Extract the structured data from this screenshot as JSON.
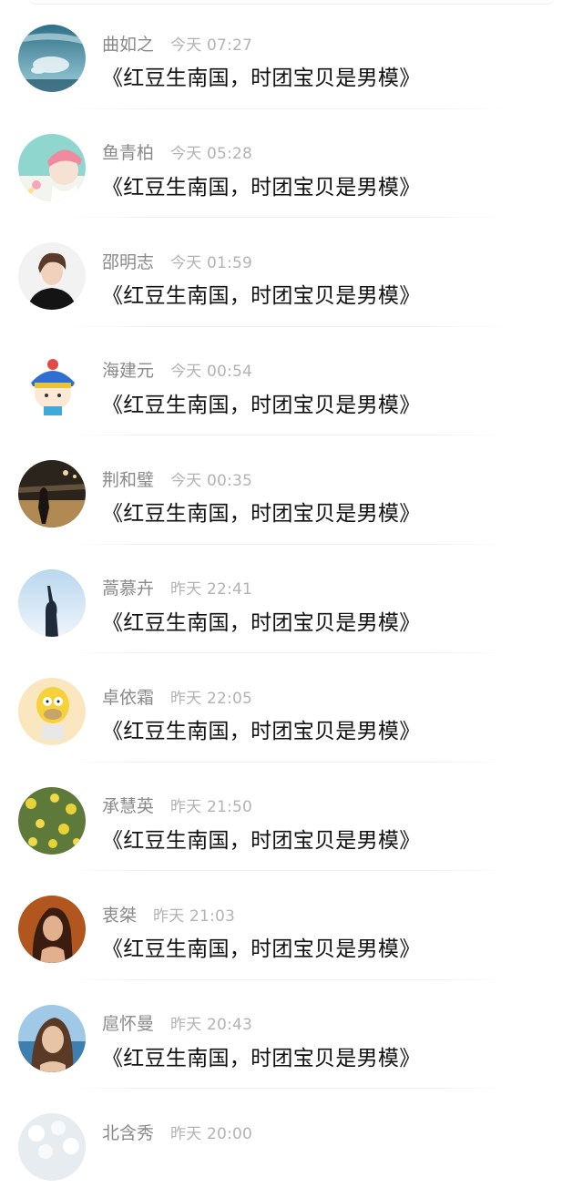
{
  "messages": [
    {
      "name": "曲如之",
      "time": "今天 07:27",
      "text": "《红豆生南国，时团宝贝是男模》",
      "avatar": "underwater-swimmer-avatar"
    },
    {
      "name": "鱼青柏",
      "time": "今天 05:28",
      "text": "《红豆生南国，时团宝贝是男模》",
      "avatar": "pink-hat-girl-avatar"
    },
    {
      "name": "邵明志",
      "time": "今天 01:59",
      "text": "《红豆生南国，时团宝贝是男模》",
      "avatar": "young-man-portrait-avatar"
    },
    {
      "name": "海建元",
      "time": "今天 00:54",
      "text": "《红豆生南国，时团宝贝是男模》",
      "avatar": "cartoon-qing-official-avatar"
    },
    {
      "name": "荆和璧",
      "time": "今天 00:35",
      "text": "《红豆生南国，时团宝贝是男模》",
      "avatar": "girl-at-night-avatar"
    },
    {
      "name": "蒿慕卉",
      "time": "昨天 22:41",
      "text": "《红豆生南国，时团宝贝是男模》",
      "avatar": "silhouette-sky-avatar"
    },
    {
      "name": "卓依霜",
      "time": "昨天 22:05",
      "text": "《红豆生南国，时团宝贝是男模》",
      "avatar": "cartoon-homer-avatar"
    },
    {
      "name": "承慧英",
      "time": "昨天 21:50",
      "text": "《红豆生南国，时团宝贝是男模》",
      "avatar": "yellow-flowers-avatar"
    },
    {
      "name": "衷桀",
      "time": "昨天 21:03",
      "text": "《红豆生南国，时团宝贝是男模》",
      "avatar": "woman-portrait-dark-avatar"
    },
    {
      "name": "扈怀曼",
      "time": "昨天 20:43",
      "text": "《红豆生南国，时团宝贝是男模》",
      "avatar": "woman-beach-avatar"
    },
    {
      "name": "北含秀",
      "time": "昨天 20:00",
      "text": "",
      "avatar": "white-flowers-avatar"
    }
  ]
}
